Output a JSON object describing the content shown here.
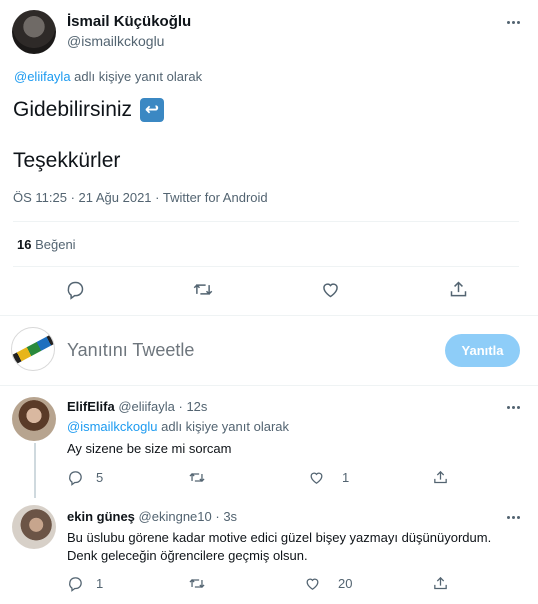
{
  "main_tweet": {
    "display_name": "İsmail Küçükoğlu",
    "handle": "@ismailkckoglu",
    "reply_context_user": "@eliifayla",
    "reply_context_suffix": " adlı kişiye yanıt olarak",
    "text_line1": "Gidebilirsiniz",
    "text_emoji": "↩",
    "text_line2": "Teşekkürler",
    "meta": "ÖS 11:25 · 21 Ağu 2021 · Twitter for Android",
    "likes_count": "16",
    "likes_label": "Beğeni"
  },
  "composer": {
    "placeholder": "Yanıtını Tweetle",
    "reply_button": "Yanıtla"
  },
  "replies": [
    {
      "display_name": "ElifElifa",
      "handle": "@eliifayla",
      "time": "· 12s",
      "reply_context_user": "@ismailkckoglu",
      "reply_context_suffix": " adlı kişiye yanıt olarak",
      "text": "Ay sizene be size mi sorcam",
      "reply_count": "5",
      "retweet_count": "",
      "like_count": "1"
    },
    {
      "display_name": "ekin güneş",
      "handle": "@ekingne10",
      "time": "· 3s",
      "text_line1": "Bu üslubu görene kadar motive edici güzel bişey yazmayı düşünüyordum.",
      "text_line2": "Denk geleceğin öğrencilere geçmiş olsun.",
      "reply_count": "1",
      "retweet_count": "",
      "like_count": "20"
    }
  ],
  "colors": {
    "accent": "#1d9bf0",
    "reply_button_disabled": "#8ecdf8",
    "text_primary": "#0f1419",
    "text_secondary": "#536471"
  }
}
